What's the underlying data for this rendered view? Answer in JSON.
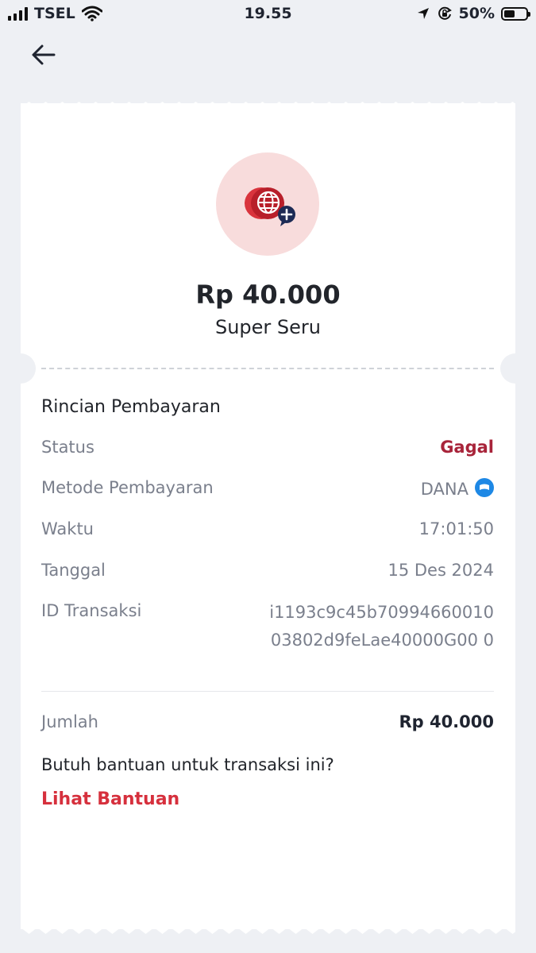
{
  "status_bar": {
    "carrier": "TSEL",
    "time": "19.55",
    "battery": "50%",
    "battery_level": 0.5
  },
  "nav": {
    "back_icon": "arrow-left-icon"
  },
  "receipt": {
    "icon": "globe-plus-icon",
    "amount": "Rp 40.000",
    "product": "Super Seru",
    "section_title": "Rincian Pembayaran",
    "rows": [
      {
        "label": "Status",
        "value": "Gagal"
      },
      {
        "label": "Metode Pembayaran",
        "value": "DANA"
      },
      {
        "label": "Waktu",
        "value": "17:01:50"
      },
      {
        "label": "Tanggal",
        "value": "15 Des 2024"
      },
      {
        "label": "ID Transaksi",
        "value": "i1193c9c45b70994660010 03802d9feLae40000G00 0"
      }
    ],
    "total_label": "Jumlah",
    "total_value": "Rp 40.000",
    "help_question": "Butuh bantuan untuk transaksi ini?",
    "help_link": "Lihat Bantuan"
  },
  "colors": {
    "failed": "#a8243a",
    "link": "#d6303d",
    "icon_bg": "#f8dcdc",
    "dana": "#1e88e5"
  }
}
